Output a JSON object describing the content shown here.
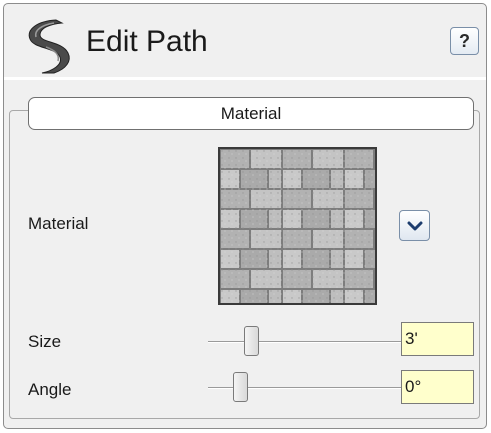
{
  "header": {
    "title": "Edit Path",
    "help_label": "?",
    "icon": "path-icon"
  },
  "material_group": {
    "tab_label": "Material",
    "material_label": "Material",
    "material_swatch": "paver-stone-texture",
    "dropdown_icon": "chevron-down-icon",
    "size": {
      "label": "Size",
      "value": "3'",
      "slider_level": 0.22
    },
    "angle": {
      "label": "Angle",
      "value": "0°",
      "slider_level": 0.15
    }
  },
  "colors": {
    "panel_background": "#f0f0f0",
    "field_background": "#ffffcc",
    "path_icon": "#4a4a4a"
  }
}
